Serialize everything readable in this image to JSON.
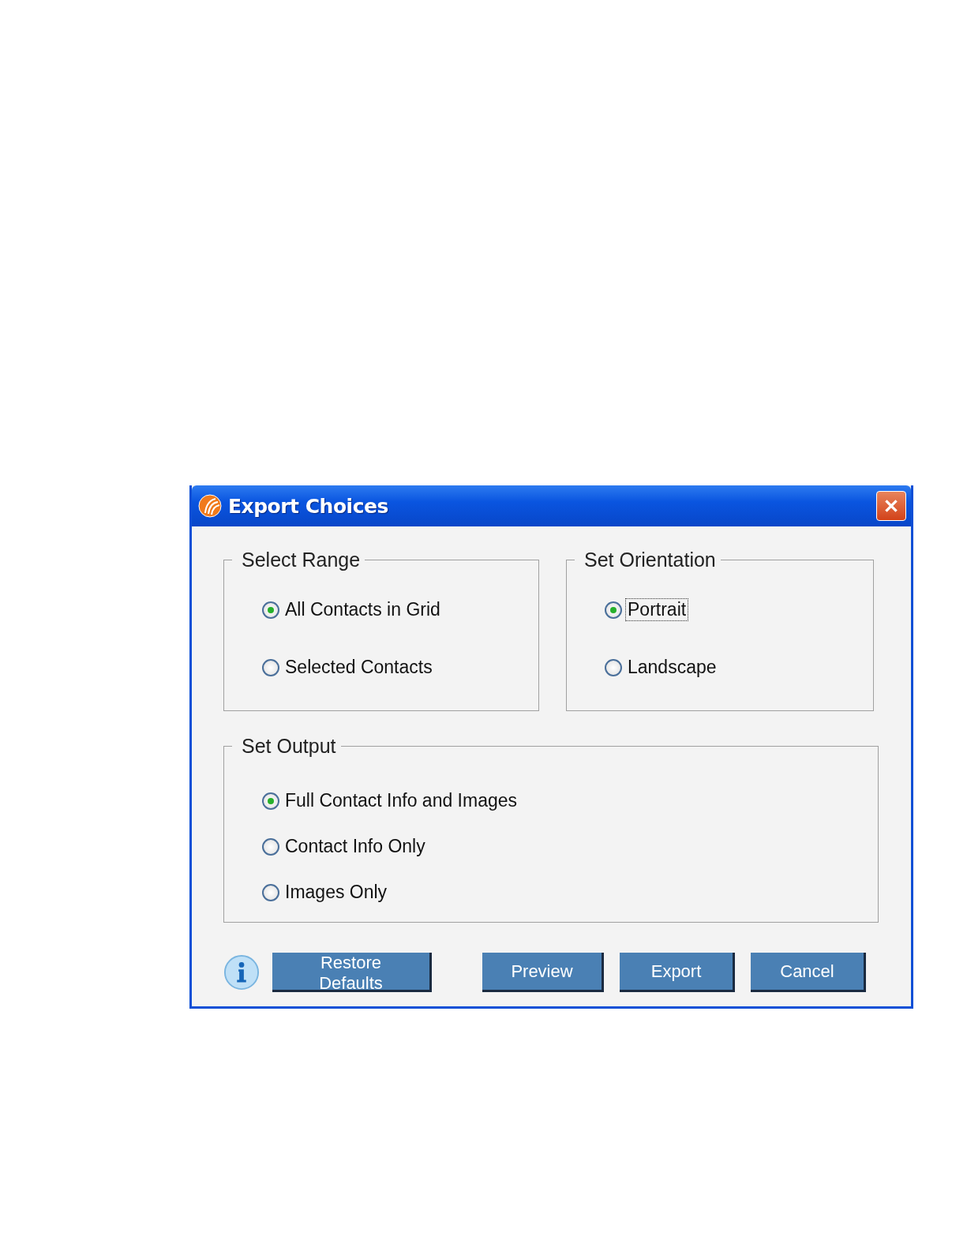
{
  "window": {
    "title": "Export Choices"
  },
  "groups": [
    {
      "title": "Select Range",
      "options": [
        {
          "label": "All Contacts in Grid",
          "selected": true,
          "focused": false
        },
        {
          "label": "Selected Contacts",
          "selected": false,
          "focused": false
        }
      ]
    },
    {
      "title": "Set Orientation",
      "options": [
        {
          "label": "Portrait",
          "selected": true,
          "focused": true
        },
        {
          "label": "Landscape",
          "selected": false,
          "focused": false
        }
      ]
    },
    {
      "title": "Set Output",
      "options": [
        {
          "label": "Full Contact Info and Images",
          "selected": true,
          "focused": false
        },
        {
          "label": "Contact Info Only",
          "selected": false,
          "focused": false
        },
        {
          "label": "Images Only",
          "selected": false,
          "focused": false
        }
      ]
    }
  ],
  "buttons": [
    "Restore Defaults",
    "Preview",
    "Export",
    "Cancel"
  ]
}
